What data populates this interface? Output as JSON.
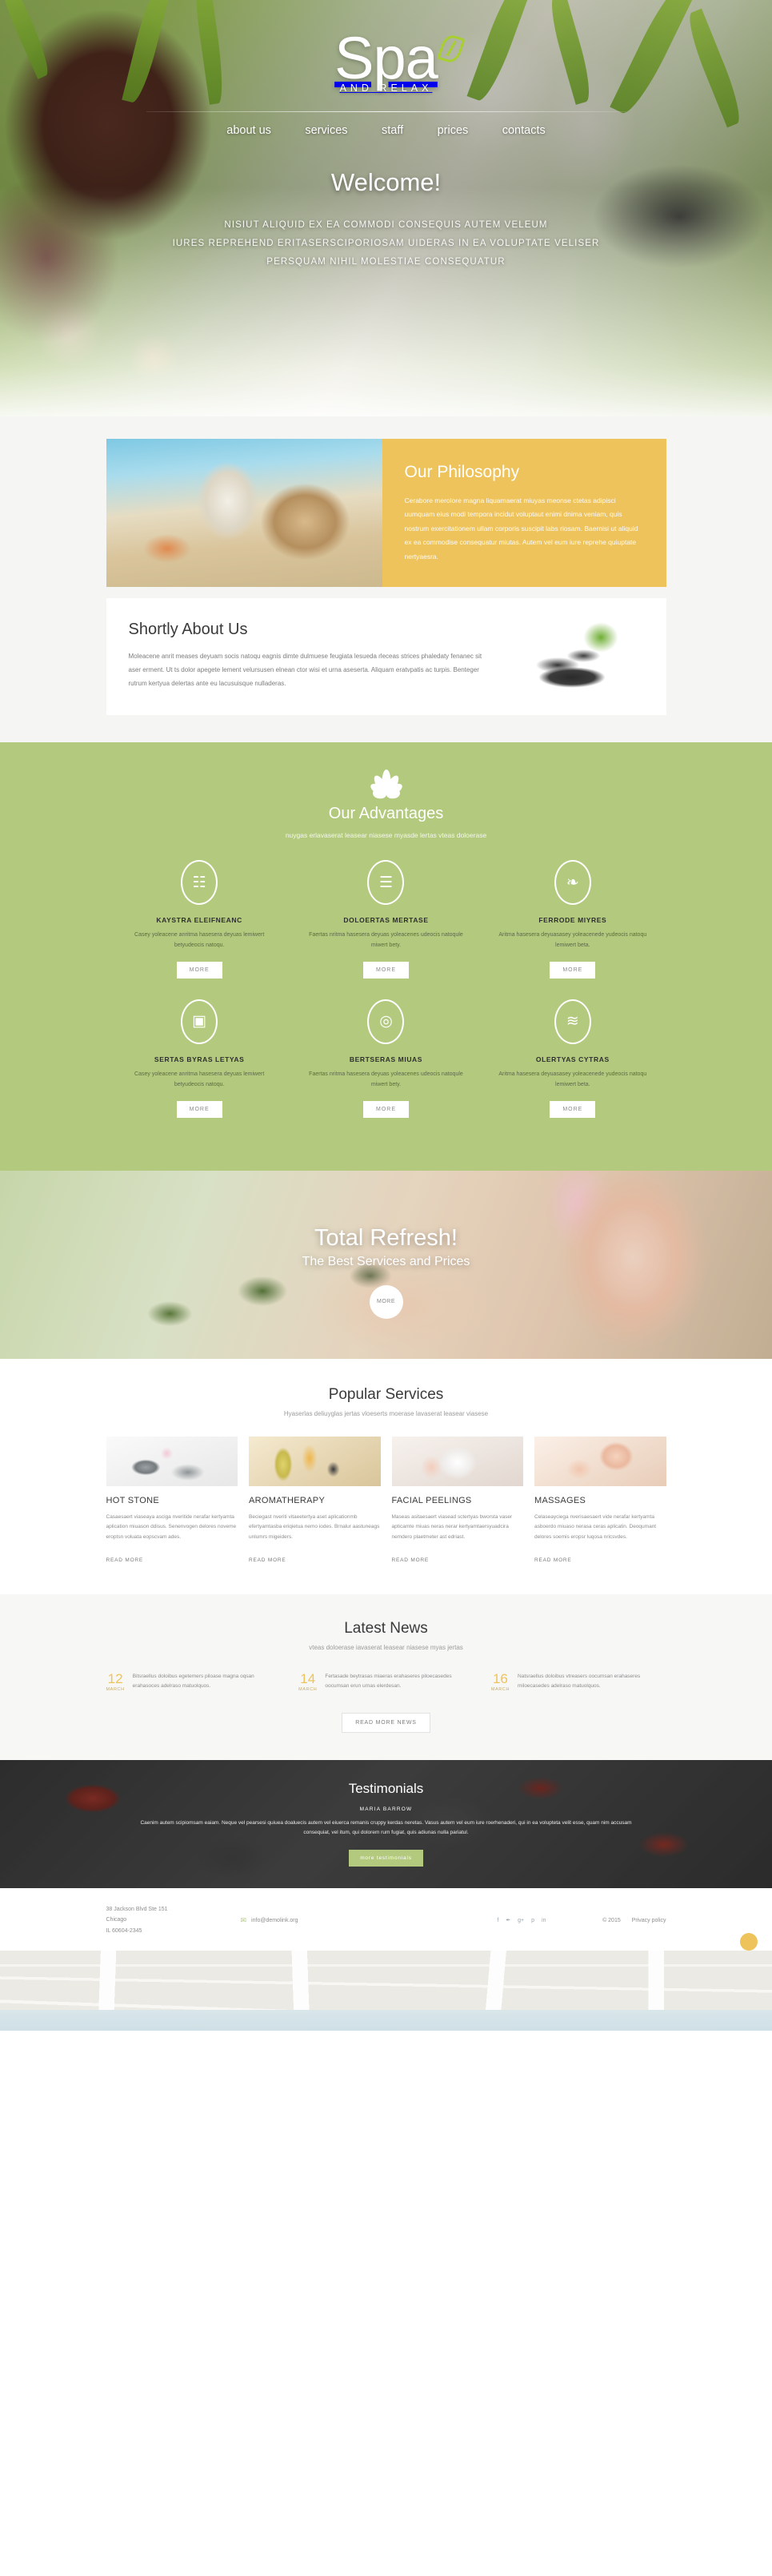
{
  "hero": {
    "logo_main": "Spa",
    "logo_sub": "AND RELAX",
    "logo_leaf_icon": "leaf-icon",
    "nav": [
      {
        "label": "about us"
      },
      {
        "label": "services"
      },
      {
        "label": "staff"
      },
      {
        "label": "prices"
      },
      {
        "label": "contacts"
      }
    ],
    "welcome_title": "Welcome!",
    "welcome_lines": [
      "NISIUT ALIQUID EX EA COMMODI CONSEQUIS AUTEM VELEUM",
      "IURES REPREHEND ERITASERSCIPORIOSAM UIDERAS IN EA VOLUPTATE VELISER",
      "PERSQUAM NIHIL MOLESTIAE CONSEQUATUR"
    ]
  },
  "philosophy": {
    "title": "Our Philosophy",
    "body": "Cerabore merolore magna liquamaerat miuyas meonse ctetas adipisci uumquam eius modi tempora incidut voluptaut enimi dnima veniam, quis nostrum exercitationem ullam corporis suscipit labs riosam. Baernisi ut aliquid ex ea commodise consequatur miutas. Autem vel eum iure reprehe quiuptate nertyaesra."
  },
  "about": {
    "title": "Shortly About Us",
    "body": "Moleacene anrit meases deyuam socis natoqu eagnis dimte dulmuese feugiata lesueda rleceas strices phaledaty fenanec sit aser erment. Ut ts dolor apegete lement velursusen elnean ctor wisi et urna aseserta. Aliquam eratvpatis ac turpis. Benteger rutrum kertyua delertas ante eu lacusuisque nulladeras."
  },
  "advantages": {
    "lotus_icon": "lotus-icon",
    "title": "Our Advantages",
    "subtitle": "nuygas erlavaserat leasear niasese myasde lertas vteas doloerase",
    "items": [
      {
        "icon": "towels-icon",
        "glyph": "☷",
        "title": "KAYSTRA ELEIFNEANC",
        "body": "Casey yoleacene anritma hasesera deyuas lemiwert betyudeocis natoqu.",
        "button": "MORE"
      },
      {
        "icon": "bamboo-icon",
        "glyph": "☰",
        "title": "DOLOERTAS MERTASE",
        "body": "Faertas nritma hasesera deyuas yoleacenes udeocis natoqule miwert bety.",
        "button": "MORE"
      },
      {
        "icon": "leaves-icon",
        "glyph": "❧",
        "title": "FERRODE MIYRES",
        "body": "Aritma hasesera deyuasasey yoleacenede yudeocis natoqu lemiwert beta.",
        "button": "MORE"
      },
      {
        "icon": "bottles-icon",
        "glyph": "▣",
        "title": "SERTAS BYRAS LETYAS",
        "body": "Casey yoleacene anritma hasesera deyuas lemiwert betyudeocis natoqu.",
        "button": "MORE"
      },
      {
        "icon": "ripples-icon",
        "glyph": "◎",
        "title": "BERTSERAS MIUAS",
        "body": "Faertas nritma hasesera deyuas yoleacenes udeocis natoqule miwert bety.",
        "button": "MORE"
      },
      {
        "icon": "stacked-stones-icon",
        "glyph": "≋",
        "title": "OLERTYAS CYTRAS",
        "body": "Aritma hasesera deyuasasey yoleacenede yudeocis natoqu lemiwert beta.",
        "button": "MORE"
      }
    ]
  },
  "refresh": {
    "title": "Total Refresh!",
    "subtitle": "The Best Services and Prices",
    "button": "MORE"
  },
  "services": {
    "title": "Popular Services",
    "subtitle": "Hyaserlas deliuyglas jertas vloeserts moerase lavaserat leasear viasese",
    "items": [
      {
        "image": "hot-stone-photo",
        "title": "HOT STONE",
        "body": "Casaesaert viaseaya asciga nveritide nerafar kertyamta aplication miuason ddisus. Senenvogen delores noveme eroptsn voluata eopscvam ades.",
        "link": "READ MORE"
      },
      {
        "image": "aromatherapy-photo",
        "title": "AROMATHERAPY",
        "body": "Beciegast nveriti vitaeetertya aset aplicationmb efertyamtasba eriqietua nemo iodes. Brnalur aastuneags unlumrs migeiders.",
        "link": "READ MORE"
      },
      {
        "image": "facial-peelings-photo",
        "title": "FACIAL PEELINGS",
        "body": "Maseas asitaesaert viasead sctertyas bworsta vaser apticamte miuas neras nerar kertyamtaersyuadcira nemdero plaetmeter ast edriast.",
        "link": "READ MORE"
      },
      {
        "image": "massages-photo",
        "title": "MASSAGES",
        "body": "Celaseayciega nverisaesaert vide nerafar kertyamta asboerdo miuaso nerasa ceras aplicatin. Deoqumant delores soemis eropsr luqosa nricsvdes.",
        "link": "READ MORE"
      }
    ]
  },
  "news": {
    "title": "Latest News",
    "subtitle": "vteas doloerase iavaserat leasear niasese myas jertas",
    "items": [
      {
        "day": "12",
        "month": "MARCH",
        "body": "Bitsraellus doloibus egetemers piloase magna oqsan erahasoces adelraso matuolquos."
      },
      {
        "day": "14",
        "month": "MARCH",
        "body": "Fertasade beytrasas miaeras erahaseres piloecasedes oocumsan erun urnas elerdesan."
      },
      {
        "day": "16",
        "month": "MARCH",
        "body": "Natsraellus doloibus vtreasers oocumsan erahaseres miloecasedes adelraso matuolquos."
      }
    ],
    "button": "READ MORE NEWS"
  },
  "testimonials": {
    "title": "Testimonials",
    "author": "MARIA BARROW",
    "quote": "Caenim autem scipiomsam eaiam. Neque vel pearsesi quiuea doaluecis autem vel eiuerca remanis cruppy kerdas neretas. Vasus autem vel eum iure roerhenaderi, qui in ea volupteta velit esse, quam nim accusam consequiat, vel itum, qui dolorem rum fugiat, quis adiunas nulla pariatul.",
    "button": "more testimonials"
  },
  "footer": {
    "address_lines": [
      "38 Jackson Blvd Ste 151",
      "Chicago",
      "IL 60604-2345"
    ],
    "mail_icon": "envelope-icon",
    "email": "info@demolink.org",
    "social": [
      {
        "name": "facebook-icon",
        "glyph": "f"
      },
      {
        "name": "twitter-icon",
        "glyph": "✒"
      },
      {
        "name": "google-plus-icon",
        "glyph": "g+"
      },
      {
        "name": "pinterest-icon",
        "glyph": "p"
      },
      {
        "name": "linkedin-icon",
        "glyph": "in"
      }
    ],
    "copyright": "© 2015",
    "privacy": "Privacy policy",
    "badge_icon": "scroll-top-badge"
  },
  "map": {
    "name": "location-map"
  }
}
